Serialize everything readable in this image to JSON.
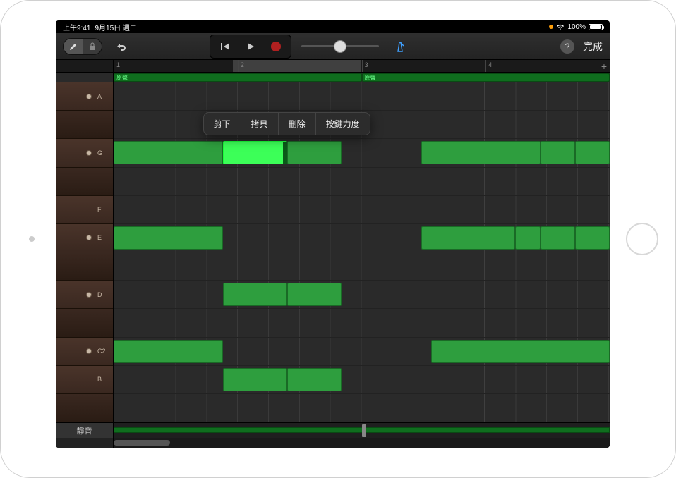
{
  "status": {
    "time": "上午9:41",
    "date": "9月15日 週二",
    "battery": "100%"
  },
  "toolbar": {
    "done_label": "完成"
  },
  "context_menu": {
    "cut": "剪下",
    "copy": "拷貝",
    "delete": "刪除",
    "velocity": "按鍵力度"
  },
  "ruler": {
    "bars": [
      "1",
      "2",
      "3",
      "4"
    ]
  },
  "regions": [
    {
      "label": "原聲",
      "left_pct": 0,
      "width_pct": 50
    },
    {
      "label": "原聲",
      "left_pct": 50,
      "width_pct": 50
    }
  ],
  "keys": [
    {
      "label": "A",
      "dot": true,
      "dark": false
    },
    {
      "label": "",
      "dot": false,
      "dark": true
    },
    {
      "label": "G",
      "dot": true,
      "dark": false
    },
    {
      "label": "",
      "dot": false,
      "dark": true
    },
    {
      "label": "F",
      "dot": false,
      "dark": false
    },
    {
      "label": "E",
      "dot": true,
      "dark": false
    },
    {
      "label": "",
      "dot": false,
      "dark": true
    },
    {
      "label": "D",
      "dot": true,
      "dark": false
    },
    {
      "label": "",
      "dot": false,
      "dark": true
    },
    {
      "label": "C2",
      "dot": true,
      "dark": false
    },
    {
      "label": "B",
      "dot": false,
      "dark": false
    },
    {
      "label": "",
      "dot": false,
      "dark": true
    }
  ],
  "mute_label": "靜音",
  "notes": [
    {
      "row": 2,
      "left_pct": 0,
      "width_pct": 22,
      "selected": false
    },
    {
      "row": 2,
      "left_pct": 22,
      "width_pct": 13,
      "selected": true
    },
    {
      "row": 2,
      "left_pct": 35,
      "width_pct": 11,
      "selected": false
    },
    {
      "row": 2,
      "left_pct": 62,
      "width_pct": 24,
      "selected": false
    },
    {
      "row": 2,
      "left_pct": 86,
      "width_pct": 7,
      "selected": false
    },
    {
      "row": 2,
      "left_pct": 93,
      "width_pct": 7,
      "selected": false
    },
    {
      "row": 5,
      "left_pct": 0,
      "width_pct": 22,
      "selected": false
    },
    {
      "row": 5,
      "left_pct": 62,
      "width_pct": 19,
      "selected": false
    },
    {
      "row": 5,
      "left_pct": 81,
      "width_pct": 5,
      "selected": false
    },
    {
      "row": 5,
      "left_pct": 86,
      "width_pct": 7,
      "selected": false
    },
    {
      "row": 5,
      "left_pct": 93,
      "width_pct": 7,
      "selected": false
    },
    {
      "row": 7,
      "left_pct": 22,
      "width_pct": 13,
      "selected": false
    },
    {
      "row": 7,
      "left_pct": 35,
      "width_pct": 11,
      "selected": false
    },
    {
      "row": 9,
      "left_pct": 0,
      "width_pct": 22,
      "selected": false
    },
    {
      "row": 9,
      "left_pct": 64,
      "width_pct": 36,
      "selected": false
    },
    {
      "row": 10,
      "left_pct": 22,
      "width_pct": 13,
      "selected": false
    },
    {
      "row": 10,
      "left_pct": 35,
      "width_pct": 11,
      "selected": false
    }
  ],
  "locator": {
    "left_pct": 24,
    "width_pct": 26
  },
  "playhead_pct": 50
}
